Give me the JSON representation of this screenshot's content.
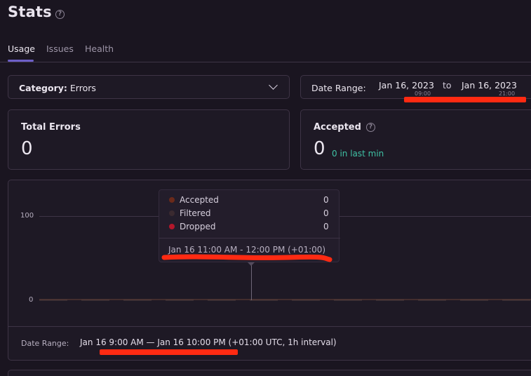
{
  "page": {
    "title": "Stats"
  },
  "tabs": [
    {
      "label": "Usage",
      "active": true
    },
    {
      "label": "Issues",
      "active": false
    },
    {
      "label": "Health",
      "active": false
    }
  ],
  "filters": {
    "category_label": "Category:",
    "category_value": "Errors",
    "date_range_label": "Date Range:",
    "start_date": "Jan 16, 2023",
    "start_time": "09:00",
    "to": "to",
    "end_date": "Jan 16, 2023",
    "end_time": "21:00"
  },
  "cards": {
    "total_errors": {
      "title": "Total Errors",
      "value": "0"
    },
    "accepted": {
      "title": "Accepted",
      "value": "0",
      "subtext": "0 in last min"
    }
  },
  "chart": {
    "y_ticks": [
      "100",
      "0"
    ],
    "footer_label": "Date Range:",
    "footer_value": "Jan 16 9:00 AM — Jan 16 10:00 PM (+01:00 UTC, 1h interval)",
    "tooltip": {
      "series": [
        {
          "name": "Accepted",
          "value": "0",
          "color": "#6b2a1a"
        },
        {
          "name": "Filtered",
          "value": "0",
          "color": "#3a2a30"
        },
        {
          "name": "Dropped",
          "value": "0",
          "color": "#b3172b"
        }
      ],
      "date": "Jan 16 11:00 AM - 12:00 PM (+01:00)"
    }
  },
  "colors": {
    "accent": "#6c5fc7",
    "success": "#3fc1a4",
    "annotation": "#ff2a12"
  },
  "chart_data": {
    "type": "line",
    "y_ticks": [
      0,
      100
    ],
    "series": [
      {
        "name": "Accepted",
        "values": [
          0
        ]
      },
      {
        "name": "Filtered",
        "values": [
          0
        ]
      },
      {
        "name": "Dropped",
        "values": [
          0
        ]
      }
    ]
  }
}
